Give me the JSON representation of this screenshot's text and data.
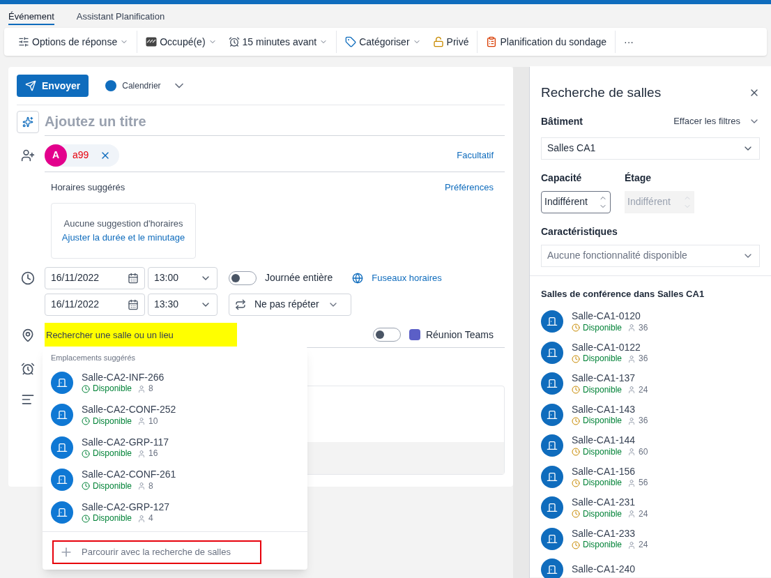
{
  "tabs": [
    {
      "label": "Événement",
      "selected": true
    },
    {
      "label": "Assistant Planification",
      "selected": false
    }
  ],
  "toolbar": [
    {
      "kind": "response",
      "label": "Options de réponse",
      "dropdown": true,
      "separator": true
    },
    {
      "kind": "busy",
      "label": "Occupé(e)",
      "dropdown": true,
      "separator": false
    },
    {
      "kind": "reminder",
      "label": "15 minutes avant",
      "dropdown": true,
      "separator": true
    },
    {
      "kind": "category",
      "label": "Catégoriser",
      "dropdown": true,
      "separator": false
    },
    {
      "kind": "private",
      "label": "Privé",
      "dropdown": false,
      "separator": true
    },
    {
      "kind": "poll",
      "label": "Planification du sondage",
      "dropdown": false,
      "separator": true
    },
    {
      "kind": "more",
      "label": "···",
      "dropdown": false,
      "separator": false
    }
  ],
  "form": {
    "send": "Envoyer",
    "calendar": {
      "label": "Calendrier",
      "color": "#0f6cbd"
    },
    "title_placeholder": "Ajoutez un titre",
    "attendee": {
      "initial": "A",
      "name": "a99",
      "color": "#e3008c"
    },
    "optional": "Facultatif",
    "suggested_label": "Horaires suggérés",
    "preferences": "Préférences",
    "no_suggestion": "Aucune suggestion d'horaires",
    "adjust": "Ajuster la durée et le minutage",
    "start": {
      "date": "16/11/2022",
      "time": "13:00"
    },
    "all_day": {
      "label": "Journée entière",
      "on": false
    },
    "timezones": "Fuseaux horaires",
    "end": {
      "date": "16/11/2022",
      "time": "13:30"
    },
    "repeat": "Ne pas répéter",
    "location": {
      "placeholder": "Rechercher une salle ou un lieu",
      "highlighted": true
    },
    "teams": {
      "label": "Réunion Teams",
      "on": false
    }
  },
  "suggestions": {
    "header": "Emplacements suggérés",
    "items": [
      {
        "name": "Salle-CA2-INF-266",
        "status": "Disponible",
        "capacity": "8"
      },
      {
        "name": "Salle-CA2-CONF-252",
        "status": "Disponible",
        "capacity": "10"
      },
      {
        "name": "Salle-CA2-GRP-117",
        "status": "Disponible",
        "capacity": "16"
      },
      {
        "name": "Salle-CA2-CONF-261",
        "status": "Disponible",
        "capacity": "8"
      },
      {
        "name": "Salle-CA2-GRP-127",
        "status": "Disponible",
        "capacity": "4"
      }
    ],
    "browse": {
      "label": "Parcourir avec la recherche de salles",
      "highlighted": true
    }
  },
  "room_finder": {
    "title": "Recherche de salles",
    "building_label": "Bâtiment",
    "clear": "Effacer les filtres",
    "building": "Salles CA1",
    "capacity_label": "Capacité",
    "capacity": "Indifférent",
    "floor_label": "Étage",
    "floor": {
      "value": "Indifférent",
      "disabled": true
    },
    "features_label": "Caractéristiques",
    "features": "Aucune fonctionnalité disponible",
    "list_title": "Salles de conférence dans Salles CA1",
    "rooms": [
      {
        "name": "Salle-CA1-0120",
        "status": "Disponible",
        "capacity": "36"
      },
      {
        "name": "Salle-CA1-0122",
        "status": "Disponible",
        "capacity": "36"
      },
      {
        "name": "Salle-CA1-137",
        "status": "Disponible",
        "capacity": "24"
      },
      {
        "name": "Salle-CA1-143",
        "status": "Disponible",
        "capacity": "36"
      },
      {
        "name": "Salle-CA1-144",
        "status": "Disponible",
        "capacity": "60"
      },
      {
        "name": "Salle-CA1-156",
        "status": "Disponible",
        "capacity": "56"
      },
      {
        "name": "Salle-CA1-231",
        "status": "Disponible",
        "capacity": "24"
      },
      {
        "name": "Salle-CA1-233",
        "status": "Disponible",
        "capacity": "24"
      },
      {
        "name": "Salle-CA1-240"
      }
    ]
  }
}
